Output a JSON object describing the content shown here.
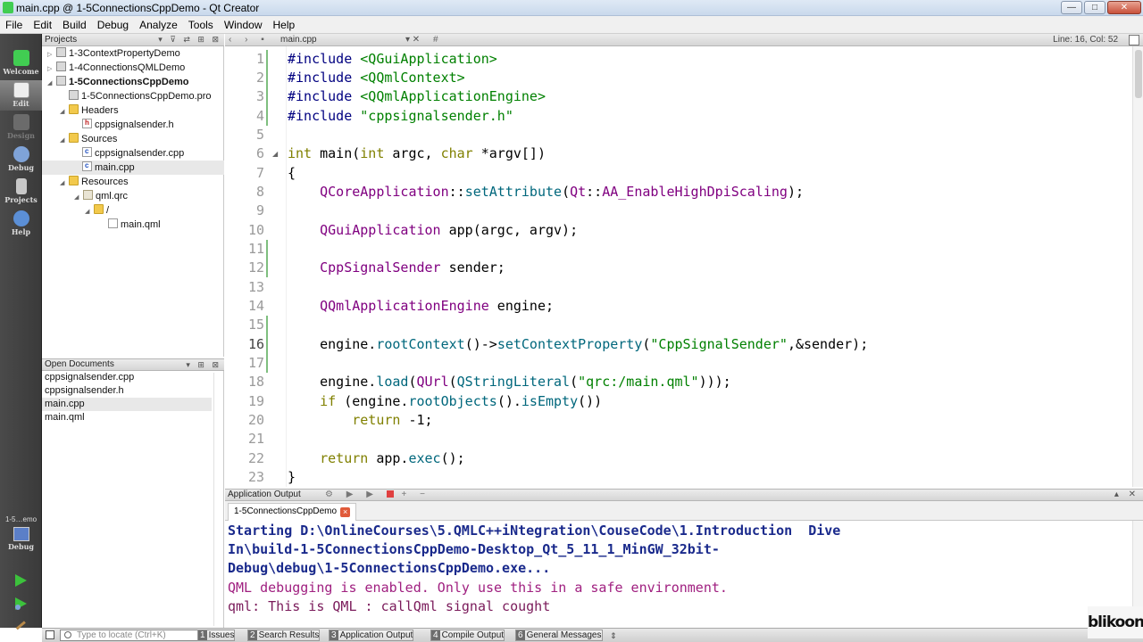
{
  "window": {
    "title": "main.cpp @ 1-5ConnectionsCppDemo - Qt Creator"
  },
  "menu": [
    "File",
    "Edit",
    "Build",
    "Debug",
    "Analyze",
    "Tools",
    "Window",
    "Help"
  ],
  "modes": {
    "welcome": "Welcome",
    "edit": "Edit",
    "design": "Design",
    "debug": "Debug",
    "projects": "Projects",
    "help": "Help",
    "kit_label": "1-5…emo",
    "kit_debug": "Debug"
  },
  "projects_pane": {
    "title": "Projects"
  },
  "tree": [
    {
      "label": "1-3ContextPropertyDemo",
      "bold": false
    },
    {
      "label": "1-4ConnectionsQMLDemo",
      "bold": false
    },
    {
      "label": "1-5ConnectionsCppDemo",
      "bold": true
    },
    {
      "label": "1-5ConnectionsCppDemo.pro",
      "bold": false
    },
    {
      "label": "Headers",
      "bold": false
    },
    {
      "label": "cppsignalsender.h",
      "bold": false
    },
    {
      "label": "Sources",
      "bold": false
    },
    {
      "label": "cppsignalsender.cpp",
      "bold": false
    },
    {
      "label": "main.cpp",
      "bold": false
    },
    {
      "label": "Resources",
      "bold": false
    },
    {
      "label": "qml.qrc",
      "bold": false
    },
    {
      "label": "/",
      "bold": false
    },
    {
      "label": "main.qml",
      "bold": false
    }
  ],
  "open_documents": {
    "title": "Open Documents",
    "items": [
      "cppsignalsender.cpp",
      "cppsignalsender.h",
      "main.cpp",
      "main.qml"
    ]
  },
  "editor": {
    "file": "main.cpp",
    "position": "Line: 16, Col: 52",
    "line_numbers": [
      "1",
      "2",
      "3",
      "4",
      "5",
      "6",
      "7",
      "8",
      "9",
      "10",
      "11",
      "12",
      "13",
      "14",
      "15",
      "16",
      "17",
      "18",
      "19",
      "20",
      "21",
      "22",
      "23"
    ],
    "code": {
      "l1": [
        "#include",
        " ",
        "<QGuiApplication>"
      ],
      "l2": [
        "#include",
        " ",
        "<QQmlContext>"
      ],
      "l3": [
        "#include",
        " ",
        "<QQmlApplicationEngine>"
      ],
      "l4": [
        "#include",
        " ",
        "\"cppsignalsender.h\""
      ],
      "l6": [
        "int",
        " main(",
        "int",
        " argc, ",
        "char",
        " *argv[])"
      ],
      "l7": "{",
      "l8": [
        "    ",
        "QCoreApplication",
        "::",
        "setAttribute",
        "(",
        "Qt",
        "::",
        "AA_EnableHighDpiScaling",
        ");"
      ],
      "l10": [
        "    ",
        "QGuiApplication",
        " app(argc, argv);"
      ],
      "l12": [
        "    ",
        "CppSignalSender",
        " sender;"
      ],
      "l14": [
        "    ",
        "QQmlApplicationEngine",
        " engine;"
      ],
      "l16": [
        "    engine.",
        "rootContext",
        "()->",
        "setContextProperty",
        "(",
        "\"CppSignalSender\"",
        ",&sender);"
      ],
      "l18": [
        "    engine.",
        "load",
        "(",
        "QUrl",
        "(",
        "QStringLiteral",
        "(",
        "\"qrc:/main.qml\"",
        ")));"
      ],
      "l19": [
        "    ",
        "if",
        " (engine.",
        "rootObjects",
        "().",
        "isEmpty",
        "())"
      ],
      "l20": [
        "        ",
        "return",
        " -1;"
      ],
      "l22": [
        "    ",
        "return",
        " app.",
        "exec",
        "();"
      ],
      "l23": "}"
    }
  },
  "output": {
    "pane_title": "Application Output",
    "tab": "1-5ConnectionsCppDemo",
    "lines": [
      "Starting D:\\OnlineCourses\\5.QMLC++iNtegration\\CouseCode\\1.Introduction  Dive",
      "In\\build-1-5ConnectionsCppDemo-Desktop_Qt_5_11_1_MinGW_32bit-",
      "Debug\\debug\\1-5ConnectionsCppDemo.exe...",
      "QML debugging is enabled. Only use this in a safe environment.",
      "qml: This is QML : callQml signal cought"
    ]
  },
  "statusbar": {
    "locator_placeholder": "Type to locate (Ctrl+K)",
    "tabs": [
      {
        "num": "1",
        "label": "Issues"
      },
      {
        "num": "2",
        "label": "Search Results"
      },
      {
        "num": "3",
        "label": "Application Output"
      },
      {
        "num": "4",
        "label": "Compile Output"
      },
      {
        "num": "6",
        "label": "General Messages"
      }
    ]
  },
  "watermark": "blikoon",
  "colors": {
    "mode_bar": "#3f3f3f",
    "keyword": "#808000",
    "type": "#800080",
    "string": "#008000",
    "function": "#00677c"
  }
}
